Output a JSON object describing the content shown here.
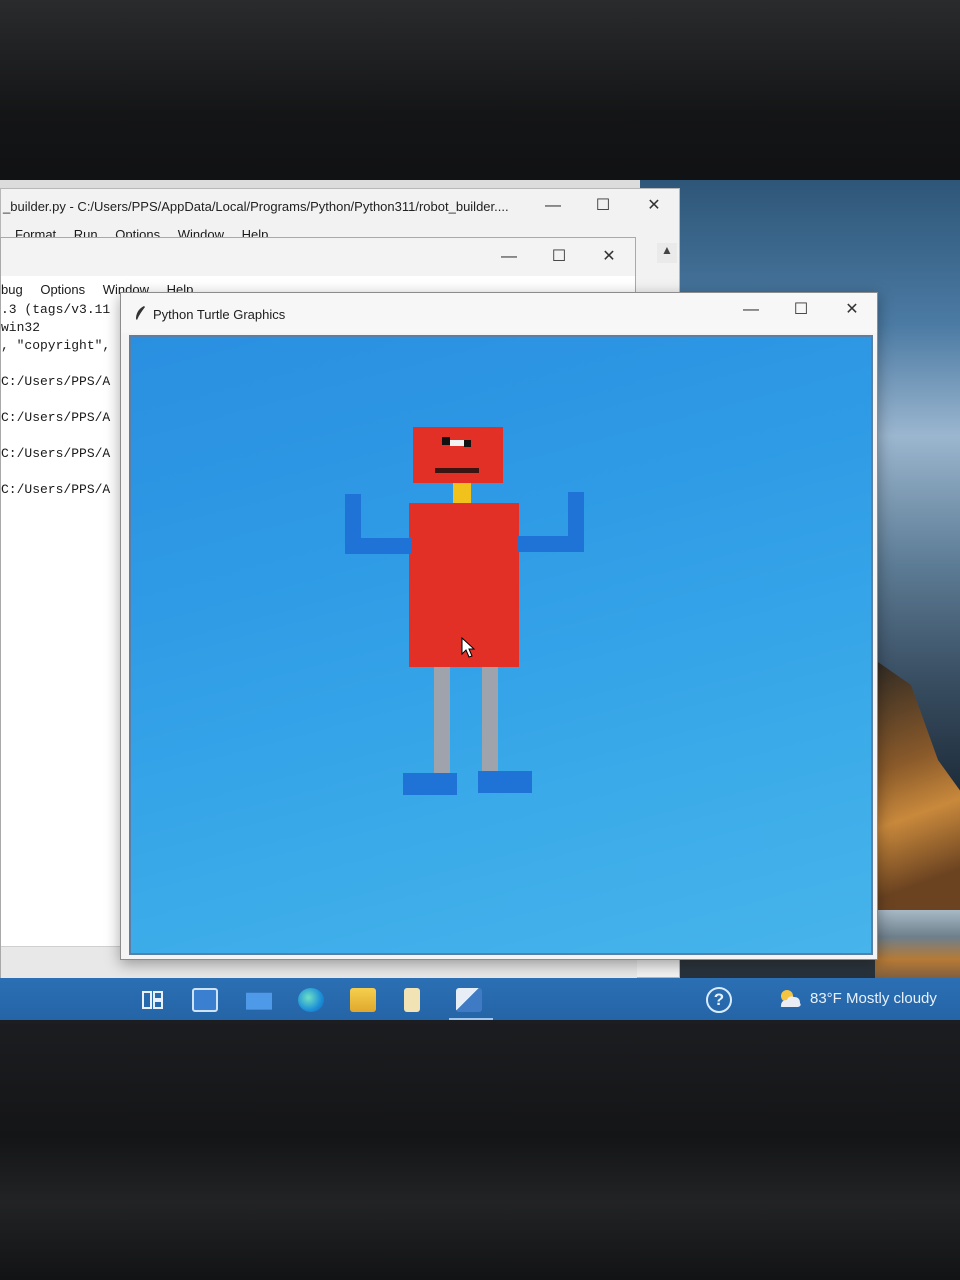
{
  "editor": {
    "title": "_builder.py - C:/Users/PPS/AppData/Local/Programs/Python/Python311/robot_builder....",
    "menu": [
      "Format",
      "Run",
      "Options",
      "Window",
      "Help"
    ]
  },
  "shell": {
    "menu": [
      "bug",
      "Options",
      "Window",
      "Help"
    ],
    "lines": [
      ".3 (tags/v3.11",
      "win32",
      ", \"copyright\",",
      "C:/Users/PPS/A",
      "C:/Users/PPS/A",
      "C:/Users/PPS/A",
      "C:/Users/PPS/A"
    ]
  },
  "turtle_window": {
    "title": "Python Turtle Graphics",
    "background_color": "#35a3e8",
    "robot_colors": {
      "head": "#e23027",
      "neck": "#f1c21b",
      "body": "#e23027",
      "arms": "#1f72d6",
      "legs": "#9fa3ab",
      "feet": "#1f72d6"
    }
  },
  "window_controls": {
    "minimize": "—",
    "maximize": "☐",
    "close": "✕"
  },
  "taskbar": {
    "icons": [
      "task-view-icon",
      "store-icon",
      "mail-icon",
      "edge-icon",
      "file-explorer-icon",
      "document-icon",
      "python-idle-icon"
    ],
    "help": "?",
    "temperature": "83°F",
    "weather": "Mostly cloudy"
  }
}
